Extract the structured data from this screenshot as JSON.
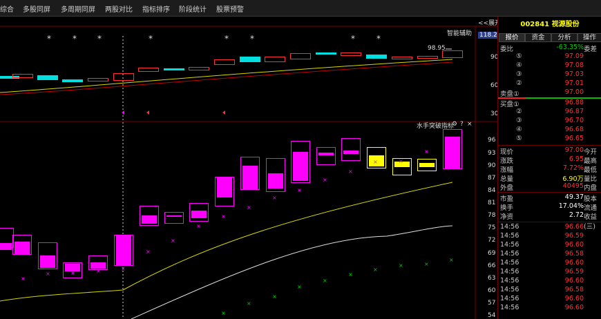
{
  "menu": [
    "综合",
    "多股同屏",
    "多周期同屏",
    "两股对比",
    "指标排序",
    "阶段统计",
    "股票预警"
  ],
  "upper_pane": {
    "label": "智能辅助",
    "price_tag": "118.25",
    "y_ticks": [
      "90",
      "60",
      "30"
    ],
    "price_label": "98.95",
    "expand_label": "<<展开"
  },
  "lower_pane": {
    "indicator_name": "水手突破指标",
    "settings_icon": "gear-icon",
    "help_label": "?",
    "close_label": "×",
    "y_ticks": [
      "96",
      "93",
      "90",
      "87",
      "84",
      "81",
      "78",
      "75",
      "72",
      "69",
      "66",
      "63",
      "60",
      "57",
      "54"
    ]
  },
  "stock": {
    "code": "002841",
    "name": "视源股份"
  },
  "tabs": [
    "报价",
    "资金",
    "分析",
    "操作"
  ],
  "weibi": {
    "label": "委比",
    "value": "-63.35%",
    "label2": "委差"
  },
  "sell": [
    {
      "label": "⑤",
      "price": "97.09"
    },
    {
      "label": "④",
      "price": "97.08"
    },
    {
      "label": "③",
      "price": "97.03"
    },
    {
      "label": "②",
      "price": "97.01"
    },
    {
      "label": "卖盘①",
      "price": "97.00"
    }
  ],
  "buy": [
    {
      "label": "买盘①",
      "price": "96.88"
    },
    {
      "label": "②",
      "price": "96.87"
    },
    {
      "label": "③",
      "price": "96.70"
    },
    {
      "label": "④",
      "price": "96.68"
    },
    {
      "label": "⑤",
      "price": "96.65"
    }
  ],
  "quote": [
    {
      "label": "现价",
      "value": "97.00",
      "label2": "今开",
      "color": "red"
    },
    {
      "label": "涨跌",
      "value": "6.95",
      "label2": "最高",
      "color": "red"
    },
    {
      "label": "涨幅",
      "value": "7.72%",
      "label2": "最低",
      "color": "red"
    },
    {
      "label": "总量",
      "value": "6.90万",
      "label2": "量比",
      "color": "yel"
    },
    {
      "label": "外盘",
      "value": "40495",
      "label2": "内盘",
      "color": "red"
    }
  ],
  "fundamentals": [
    {
      "label": "市盈",
      "value": "49.37",
      "label2": "股本"
    },
    {
      "label": "换手",
      "value": "17.04%",
      "label2": "流通"
    },
    {
      "label": "净资",
      "value": "2.72",
      "label2": "收益(三)"
    }
  ],
  "ticks": [
    {
      "time": "14:56",
      "price": "96.66"
    },
    {
      "time": "14:56",
      "price": "96.59"
    },
    {
      "time": "14:56",
      "price": "96.60"
    },
    {
      "time": "14:56",
      "price": "96.58"
    },
    {
      "time": "14:56",
      "price": "96.60"
    },
    {
      "time": "14:56",
      "price": "96.59"
    },
    {
      "time": "14:56",
      "price": "96.60"
    },
    {
      "time": "14:56",
      "price": "96.58"
    },
    {
      "time": "14:56",
      "price": "96.60"
    },
    {
      "time": "14:56",
      "price": "96.60"
    }
  ],
  "colors": {
    "up": "#ff00ff",
    "yellow": "#ffff00",
    "cyan": "#00e0e0",
    "bg": "#000000",
    "red": "#ff3030",
    "green": "#00d000"
  }
}
